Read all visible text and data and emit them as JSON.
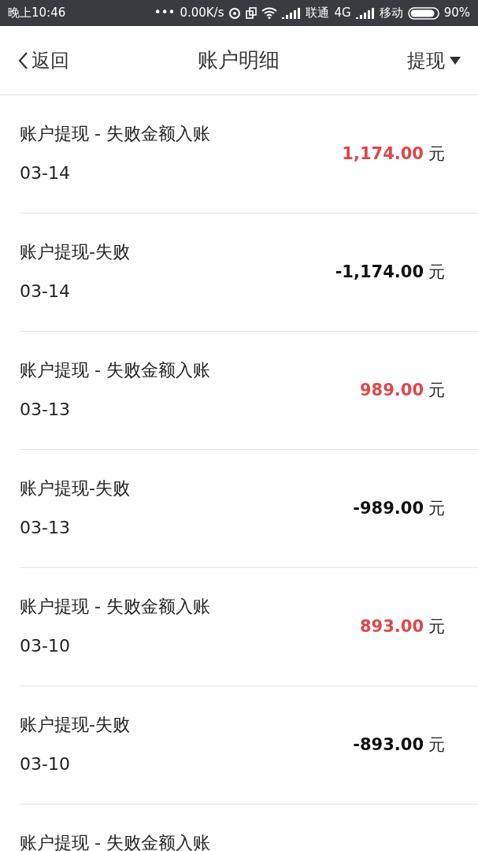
{
  "status_bar": {
    "time": "晚上10:46",
    "dots": "•••",
    "speed": "0.00K/s",
    "carrier1": "联通",
    "network": "4G",
    "carrier2": "移动",
    "battery": "90%"
  },
  "header": {
    "back": "返回",
    "title": "账户明细",
    "filter": "提现"
  },
  "records": [
    {
      "title": "账户提现 - 失败金额入账",
      "date": "03-14",
      "amount": "1,174.00",
      "unit": "元",
      "kind": "income"
    },
    {
      "title": "账户提现-失败",
      "date": "03-14",
      "amount": "-1,174.00",
      "unit": "元",
      "kind": "expense"
    },
    {
      "title": "账户提现 - 失败金额入账",
      "date": "03-13",
      "amount": "989.00",
      "unit": "元",
      "kind": "income"
    },
    {
      "title": "账户提现-失败",
      "date": "03-13",
      "amount": "-989.00",
      "unit": "元",
      "kind": "expense"
    },
    {
      "title": "账户提现 - 失败金额入账",
      "date": "03-10",
      "amount": "893.00",
      "unit": "元",
      "kind": "income"
    },
    {
      "title": "账户提现-失败",
      "date": "03-10",
      "amount": "-893.00",
      "unit": "元",
      "kind": "expense"
    },
    {
      "title": "账户提现 - 失败金额入账"
    }
  ]
}
